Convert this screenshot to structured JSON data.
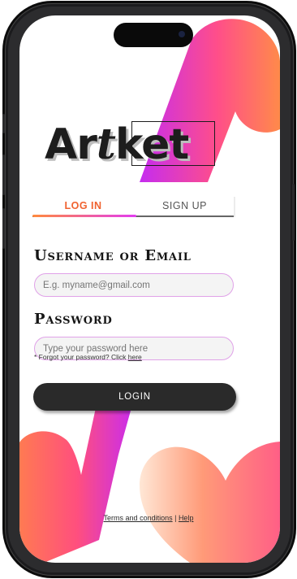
{
  "brand": {
    "part1": "Ar",
    "part2": "t",
    "part3": "ket"
  },
  "tabs": [
    {
      "label": "LOG IN",
      "active": true
    },
    {
      "label": "SIGN UP",
      "active": false
    }
  ],
  "form": {
    "username_label": "Username or Email",
    "username_placeholder": "E.g. myname@gmail.com",
    "password_label": "Password",
    "password_placeholder": "Type your password here",
    "forgot_prefix": "* Forgot your password? Click ",
    "forgot_link": "here",
    "login_label": "LOGIN"
  },
  "footer": {
    "terms": "Terms and conditions",
    "separator": " | ",
    "help": "Help"
  },
  "colors": {
    "accent_orange": "#f0622f",
    "accent_magenta": "#e23cf0",
    "dark": "#2a2a2a"
  }
}
